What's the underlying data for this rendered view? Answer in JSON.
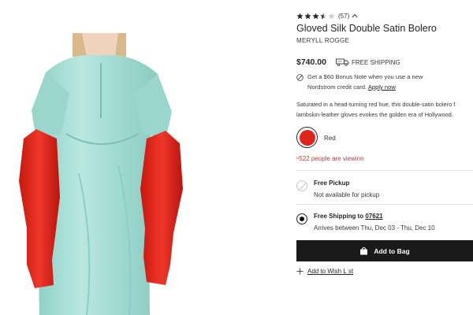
{
  "product": {
    "rating_value": 3.5,
    "rating_max": 5,
    "rating_count": "(57)",
    "title": "Gloved Silk Double Satin Bolero",
    "brand": "MERYLL ROGGE",
    "price": "$740.00",
    "shipping_label": "FREE SHIPPING",
    "bonus_line1": "Get a $60 Bonus Note when you use a new",
    "bonus_line2_prefix": "Nordstrom credit card.",
    "bonus_link": "Apply now",
    "description_line1": "Saturated in a head-turning red hue, this double-satin bolero f",
    "description_line2": "lambskin-leather gloves evokes the golden era of Hollywood.",
    "selected_color": "Red",
    "selected_color_hex": "#e0241b",
    "viewing_text": "522 people are viewinn",
    "viewing_prefix": "⁶"
  },
  "fulfillment": {
    "pickup_title": "Free Pickup",
    "pickup_status": "Not available for pickup",
    "shipping_title_prefix": "Free Shipping to",
    "shipping_zip": "07621",
    "shipping_dates": "Arrives between Thu, Dec 03 - Thu, Dec 10"
  },
  "actions": {
    "add_to_bag": "Add to Bag",
    "wish_list": "Add to Wish L st"
  },
  "icons": {
    "star_full": "star-filled-icon",
    "star_half": "star-half-icon",
    "star_empty": "star-empty-icon",
    "chevron": "chevron-up-icon",
    "truck": "delivery-truck-icon",
    "bonus": "no-fee-icon",
    "bag": "shopping-bag-icon",
    "plus": "plus-icon"
  },
  "colors": {
    "button_bg": "#1a1a1a",
    "satin": "#a8ded6",
    "glove_red": "#e0241b",
    "viewing_text": "#b0413e"
  }
}
